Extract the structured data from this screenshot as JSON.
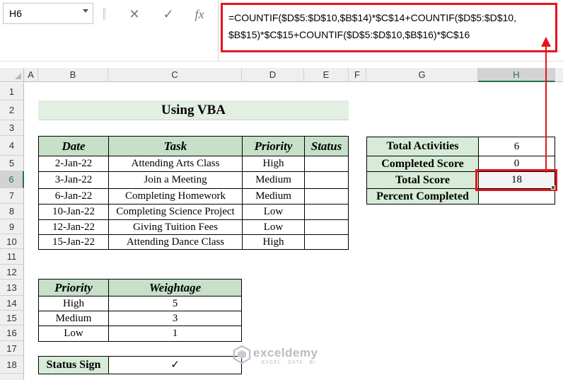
{
  "formula_bar": {
    "cell_ref": "H6",
    "cancel_icon": "✕",
    "enter_icon": "✓",
    "fx_label": "fx",
    "formula_line1": "=COUNTIF($D$5:$D$10,$B$14)*$C$14+COUNTIF($D$5:$D$10,",
    "formula_line2": "$B$15)*$C$15+COUNTIF($D$5:$D$10,$B$16)*$C$16"
  },
  "columns": [
    "A",
    "B",
    "C",
    "D",
    "E",
    "F",
    "G",
    "H"
  ],
  "rows": [
    "1",
    "2",
    "3",
    "4",
    "5",
    "6",
    "7",
    "8",
    "9",
    "10",
    "11",
    "12",
    "13",
    "14",
    "15",
    "16",
    "17",
    "18"
  ],
  "title": "Using VBA",
  "task_table": {
    "headers": [
      "Date",
      "Task",
      "Priority",
      "Status"
    ],
    "rows": [
      [
        "2-Jan-22",
        "Attending Arts Class",
        "High",
        ""
      ],
      [
        "3-Jan-22",
        "Join a Meeting",
        "Medium",
        ""
      ],
      [
        "6-Jan-22",
        "Completing Homework",
        "Medium",
        ""
      ],
      [
        "10-Jan-22",
        "Completing Science Project",
        "Low",
        ""
      ],
      [
        "12-Jan-22",
        "Giving Tuition Fees",
        "Low",
        ""
      ],
      [
        "15-Jan-22",
        "Attending Dance Class",
        "High",
        ""
      ]
    ]
  },
  "summary_table": {
    "rows": [
      [
        "Total Activities",
        "6"
      ],
      [
        "Completed Score",
        "0"
      ],
      [
        "Total Score",
        "18"
      ],
      [
        "Percent Completed",
        ""
      ]
    ]
  },
  "weight_table": {
    "headers": [
      "Priority",
      "Weightage"
    ],
    "rows": [
      [
        "High",
        "5"
      ],
      [
        "Medium",
        "3"
      ],
      [
        "Low",
        "1"
      ]
    ]
  },
  "status_sign": {
    "label": "Status Sign",
    "value": "✓"
  },
  "watermark": {
    "name": "exceldemy",
    "tagline": "EXCEL · DATA · BI"
  },
  "colors": {
    "accent_red": "#e8131b",
    "header_green": "#c6e0c9",
    "excel_green": "#217346"
  }
}
